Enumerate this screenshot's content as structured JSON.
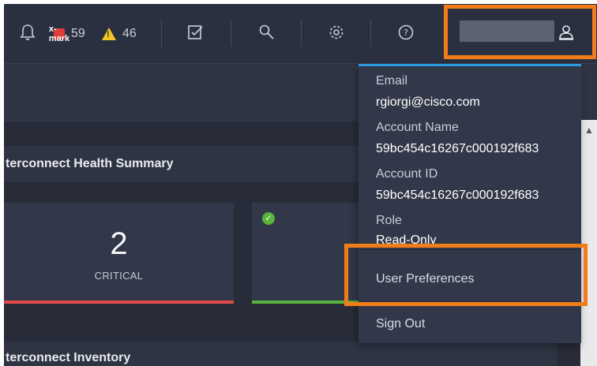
{
  "topbar": {
    "critical_count": "59",
    "warning_count": "46",
    "critical_icon": "x-mark",
    "warning_icon": "!",
    "icons": [
      "bell-icon",
      "tasks-icon",
      "search-icon",
      "settings-icon",
      "help-icon",
      "user-icon"
    ]
  },
  "content": {
    "health_title": "terconnect Health Summary",
    "critical_value": "2",
    "critical_label": "CRITICAL",
    "inventory_title": "terconnect Inventory"
  },
  "user_menu": {
    "email_label": "Email",
    "email_value": "rgiorgi@cisco.com",
    "account_name_label": "Account Name",
    "account_name_value": "59bc454c16267c000192f683",
    "account_id_label": "Account ID",
    "account_id_value": "59bc454c16267c000192f683",
    "role_label": "Role",
    "role_value": "Read-Only",
    "preferences_label": "User Preferences",
    "signout_label": "Sign Out"
  },
  "colors": {
    "highlight": "#f07d1a",
    "critical": "#e24b4b",
    "healthy": "#59b33d",
    "warning": "#f3c623",
    "accent": "#2b9be0"
  }
}
